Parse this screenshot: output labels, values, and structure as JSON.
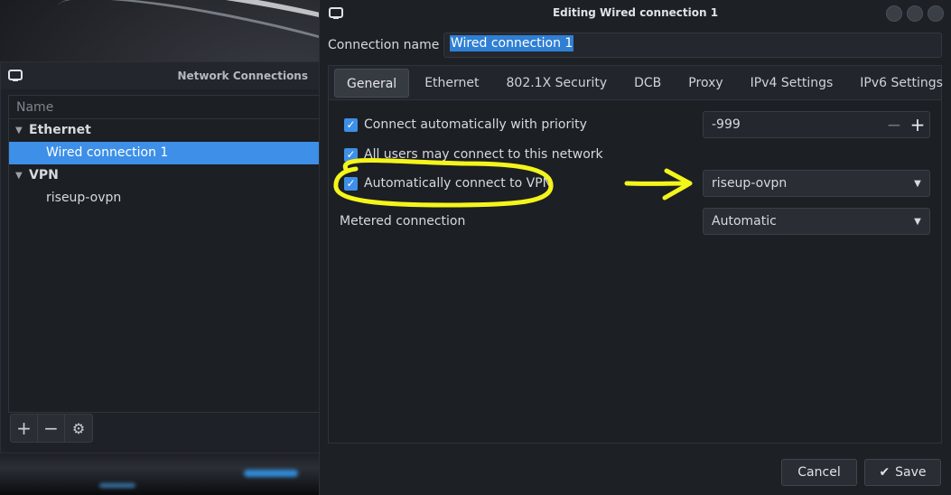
{
  "nc_window": {
    "title": "Network Connections",
    "column_header": "Name",
    "groups": [
      {
        "label": "Ethernet",
        "items": [
          "Wired connection 1"
        ]
      },
      {
        "label": "VPN",
        "items": [
          "riseup-ovpn"
        ]
      }
    ],
    "selected_item": "Wired connection 1",
    "toolbar": {
      "add": "+",
      "remove": "−",
      "settings": "⚙"
    }
  },
  "edit_window": {
    "title": "Editing Wired connection 1",
    "connection_name_label": "Connection name",
    "connection_name_value": "Wired connection 1",
    "tabs": [
      "General",
      "Ethernet",
      "802.1X Security",
      "DCB",
      "Proxy",
      "IPv4 Settings",
      "IPv6 Settings"
    ],
    "active_tab": "General",
    "general": {
      "auto_connect_label": "Connect automatically with priority",
      "auto_connect_checked": true,
      "priority_value": "-999",
      "all_users_label": "All users may connect to this network",
      "all_users_checked": true,
      "auto_vpn_label": "Automatically connect to VPN",
      "auto_vpn_checked": true,
      "vpn_selected": "riseup-ovpn",
      "metered_label": "Metered connection",
      "metered_value": "Automatic"
    },
    "buttons": {
      "cancel": "Cancel",
      "save": "Save",
      "save_icon": "✔"
    }
  },
  "annotation": {
    "color": "#f4f51a"
  },
  "colors": {
    "accent": "#3d8fe8",
    "selection": "#2f7fd4"
  }
}
